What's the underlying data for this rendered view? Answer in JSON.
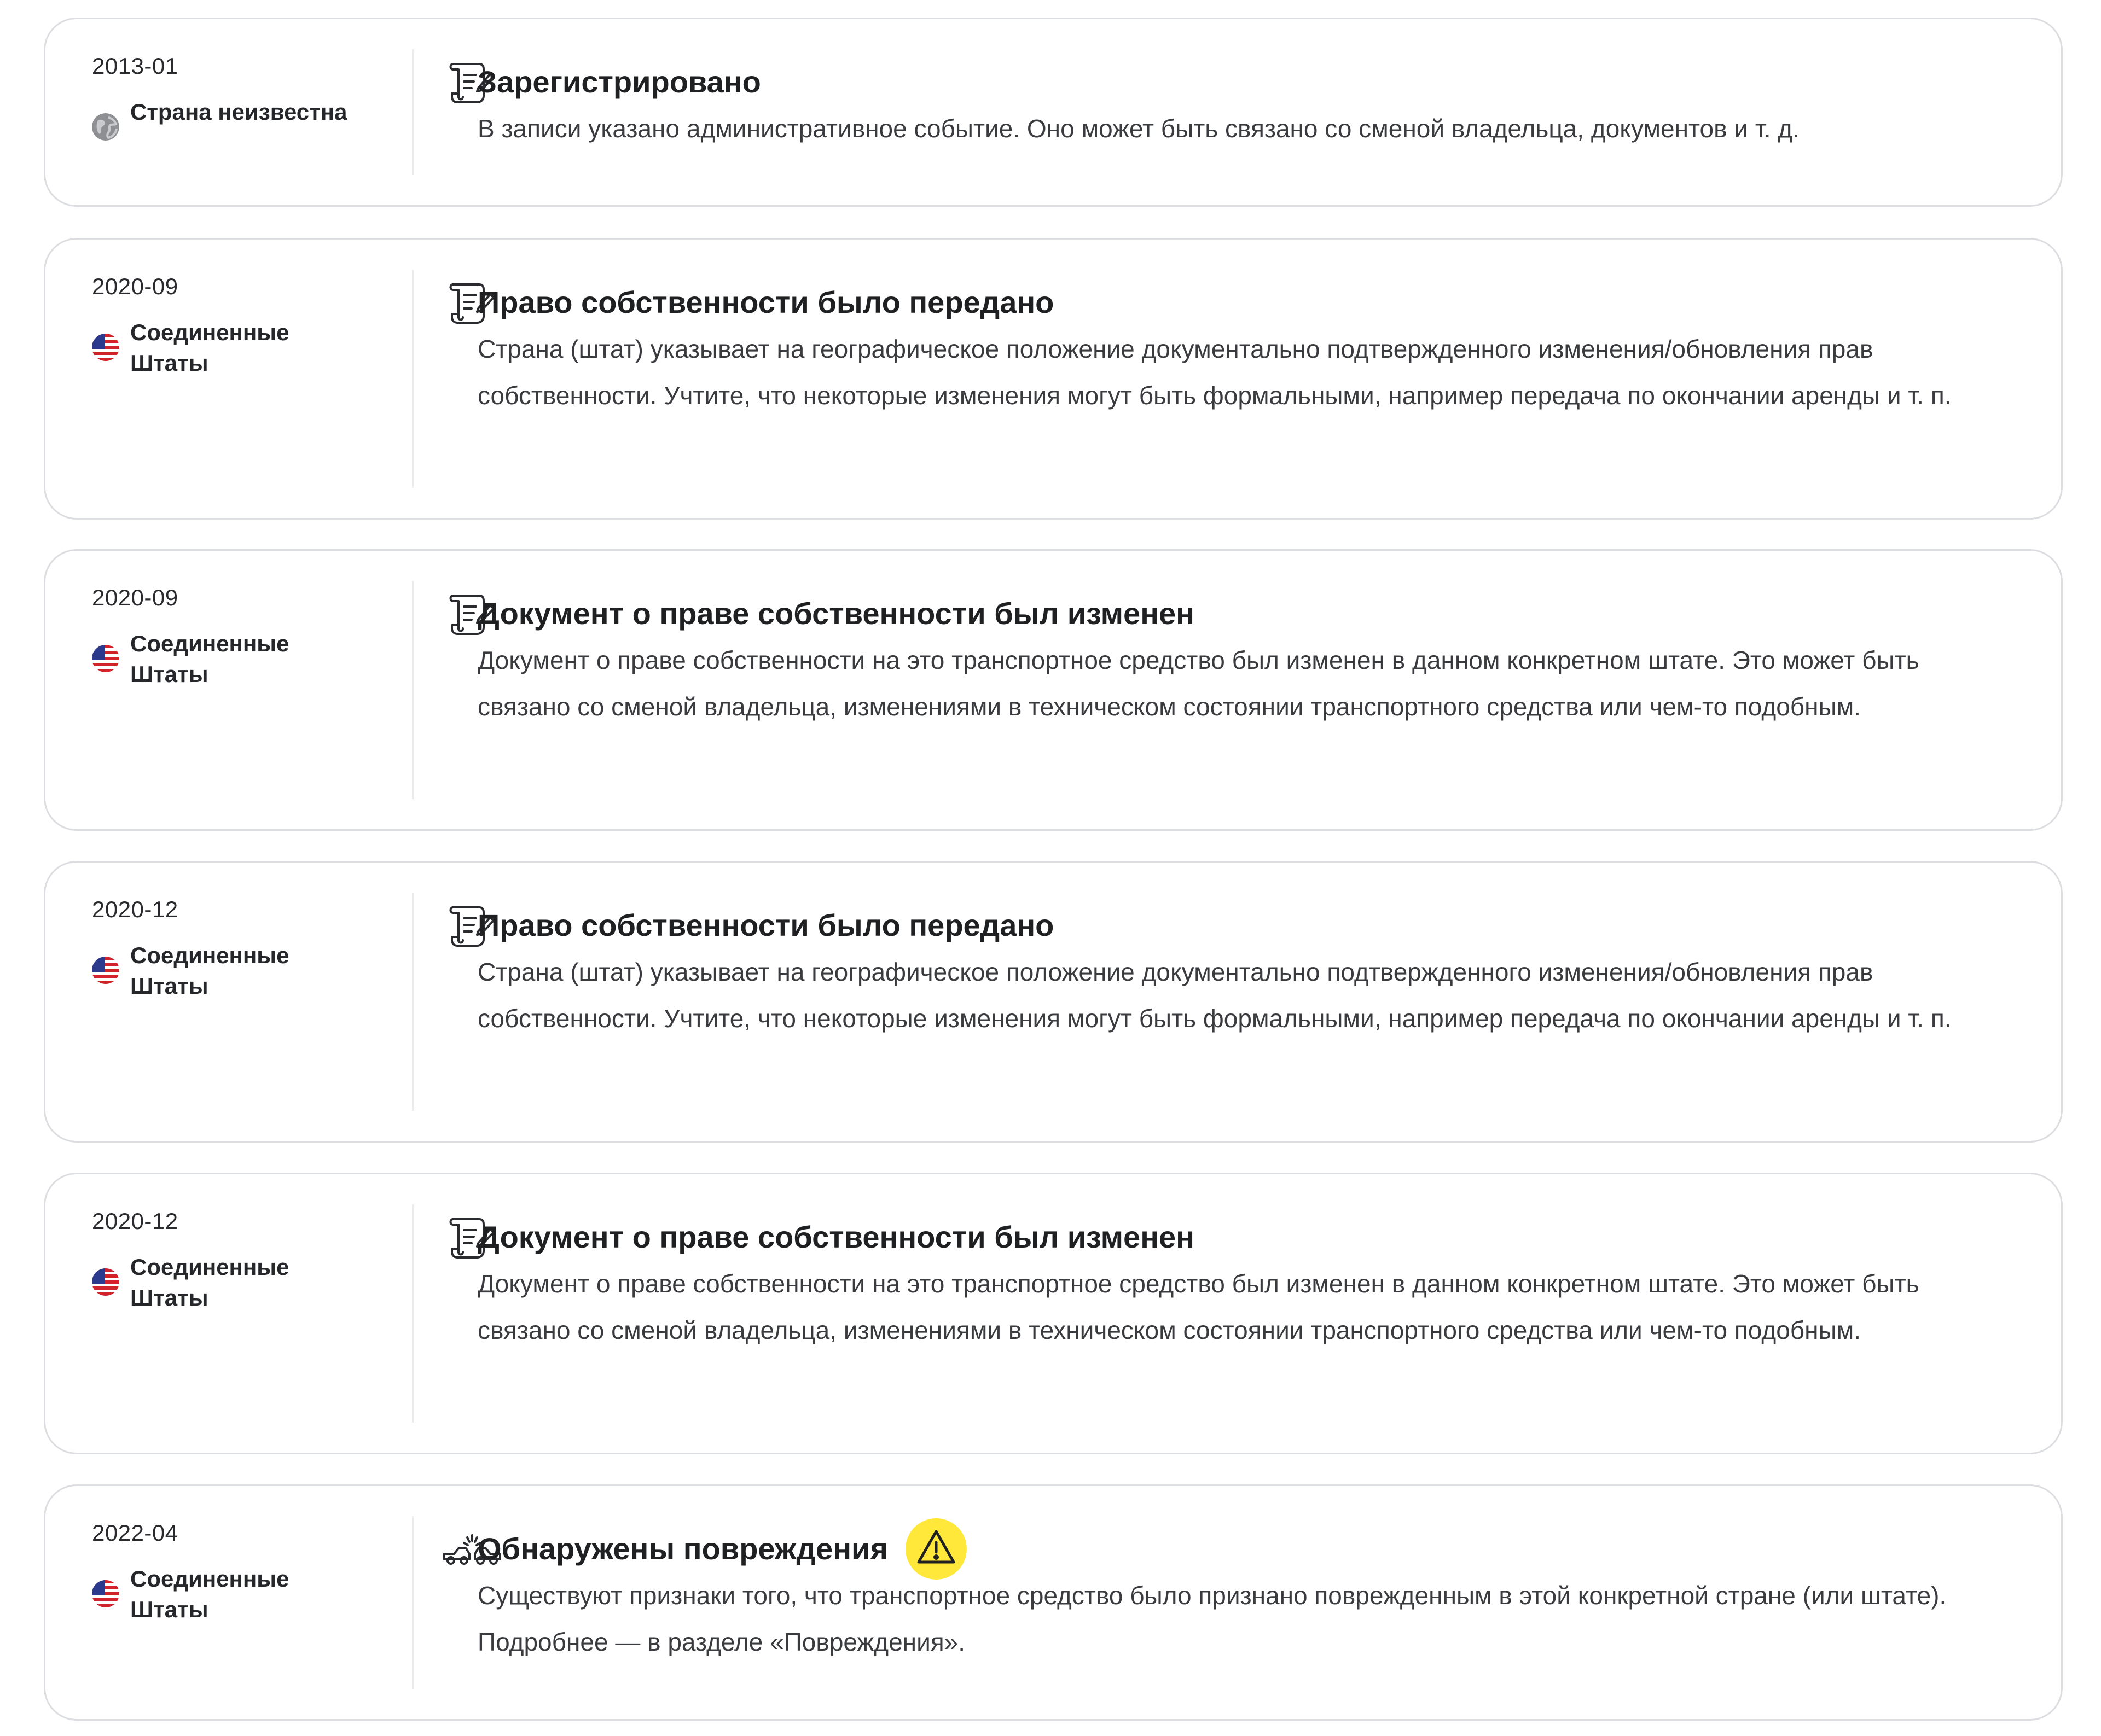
{
  "accent_colors": {
    "border": "#dcdde0",
    "warning_badge": "#ffe83a",
    "text_primary": "#1f2022",
    "text_secondary": "#3a3b3e"
  },
  "events": [
    {
      "date": "2013-01",
      "country": "Страна неизвестна",
      "country_icon": "globe-icon",
      "event_icon": "document-scroll-icon",
      "title": "Зарегистрировано",
      "description": "В записи указано административное событие. Оно может быть связано со сменой владельца, документов и т. д.",
      "warning": false
    },
    {
      "date": "2020-09",
      "country": "Соединенные Штаты",
      "country_icon": "us-flag-icon",
      "event_icon": "document-scroll-icon",
      "title": "Право собственности было передано",
      "description": "Страна (штат) указывает на географическое положение документально подтвержденного изменения/обновления прав собственности. Учтите, что некоторые изменения могут быть формальными, например передача по окончании аренды и т. п.",
      "warning": false
    },
    {
      "date": "2020-09",
      "country": "Соединенные Штаты",
      "country_icon": "us-flag-icon",
      "event_icon": "document-scroll-icon",
      "title": "Документ о праве собственности был изменен",
      "description": "Документ о праве собственности на это транспортное средство был изменен в данном конкретном штате. Это может быть связано со сменой владельца, изменениями в техническом состоянии транспортного средства или чем-то подобным.",
      "warning": false
    },
    {
      "date": "2020-12",
      "country": "Соединенные Штаты",
      "country_icon": "us-flag-icon",
      "event_icon": "document-scroll-icon",
      "title": "Право собственности было передано",
      "description": "Страна (штат) указывает на географическое положение документально подтвержденного изменения/обновления прав собственности. Учтите, что некоторые изменения могут быть формальными, например передача по окончании аренды и т. п.",
      "warning": false
    },
    {
      "date": "2020-12",
      "country": "Соединенные Штаты",
      "country_icon": "us-flag-icon",
      "event_icon": "document-scroll-icon",
      "title": "Документ о праве собственности был изменен",
      "description": "Документ о праве собственности на это транспортное средство был изменен в данном конкретном штате. Это может быть связано со сменой владельца, изменениями в техническом состоянии транспортного средства или чем-то подобным.",
      "warning": false
    },
    {
      "date": "2022-04",
      "country": "Соединенные Штаты",
      "country_icon": "us-flag-icon",
      "event_icon": "car-crash-icon",
      "title": "Обнаружены повреждения",
      "description": "Существуют признаки того, что транспортное средство было признано поврежденным в этой конкретной стране (или штате). Подробнее — в разделе «Повреждения».",
      "warning": true,
      "warning_icon": "warning-triangle-icon"
    }
  ]
}
